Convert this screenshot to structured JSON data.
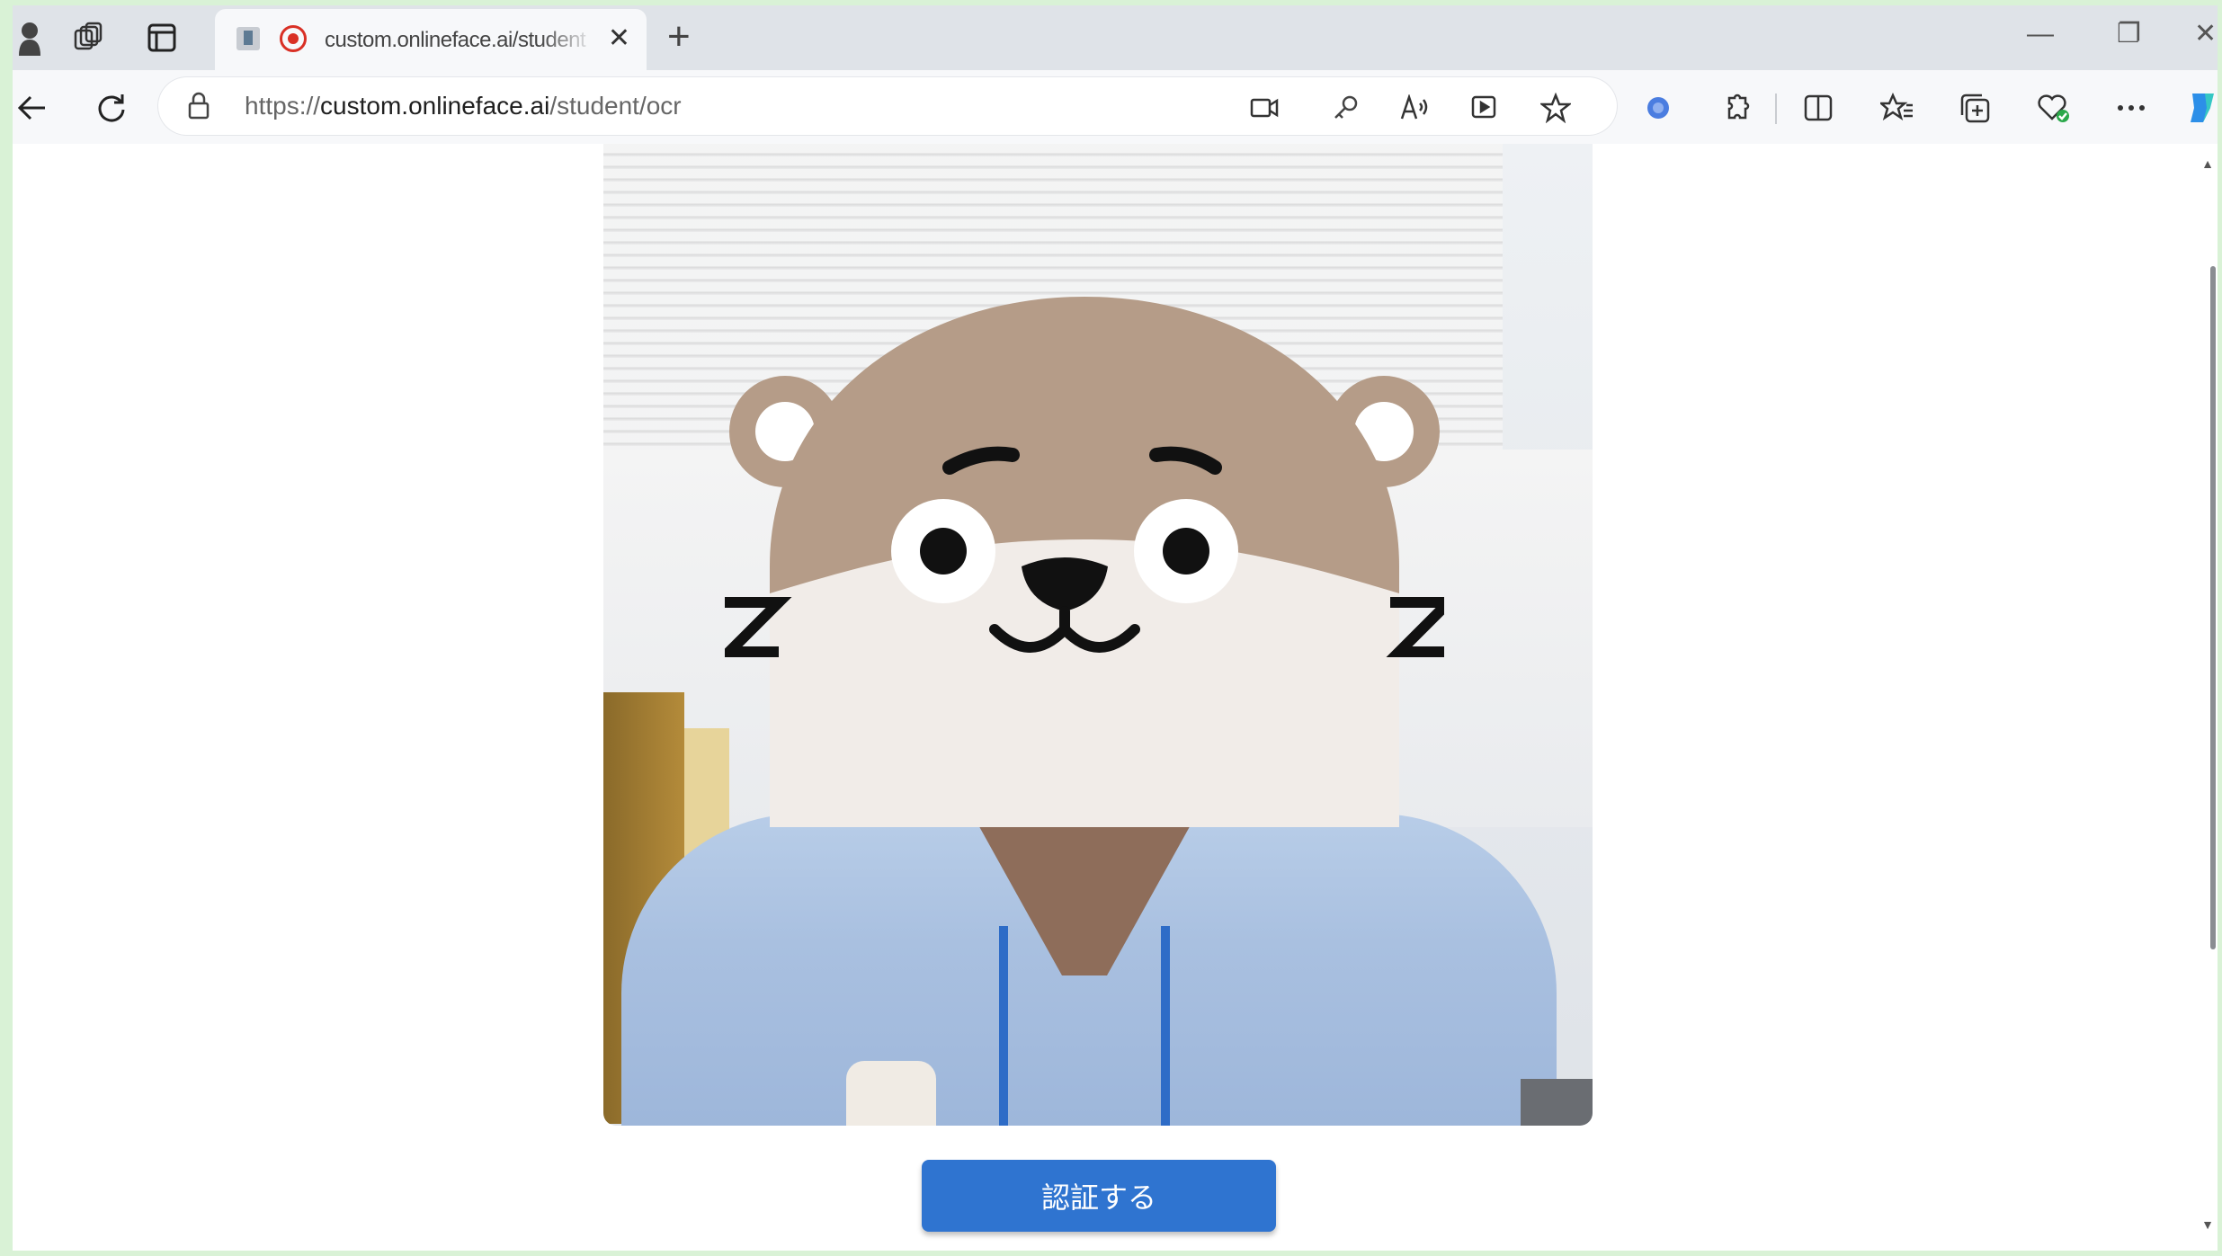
{
  "browser": {
    "tab": {
      "title": "custom.onlineface.ai/student",
      "close_glyph": "✕"
    },
    "new_tab_glyph": "+",
    "window_controls": {
      "minimize": "—",
      "restore": "❐",
      "close": "✕"
    },
    "address_bar": {
      "scheme": "https://",
      "host": "custom.onlineface.ai",
      "path": "/student/ocr"
    },
    "icons": [
      "profile-icon",
      "workspaces-icon",
      "tab-actions-icon",
      "tab-favicon-icon",
      "recording-icon",
      "back-icon",
      "refresh-icon",
      "lock-icon",
      "video-icon",
      "key-icon",
      "read-aloud-icon",
      "media-icon",
      "favorite-star-icon",
      "extension-blue-icon",
      "extensions-icon",
      "split-screen-icon",
      "favorites-icon",
      "collections-icon",
      "browser-essentials-icon",
      "more-icon",
      "copilot-icon"
    ]
  },
  "page": {
    "verify_button_label": "認証する"
  },
  "colors": {
    "button": "#2f74d0",
    "mascot_fur": "#b59c88",
    "mascot_face": "#f1ece8",
    "page_frame": "#d9f2d6"
  }
}
